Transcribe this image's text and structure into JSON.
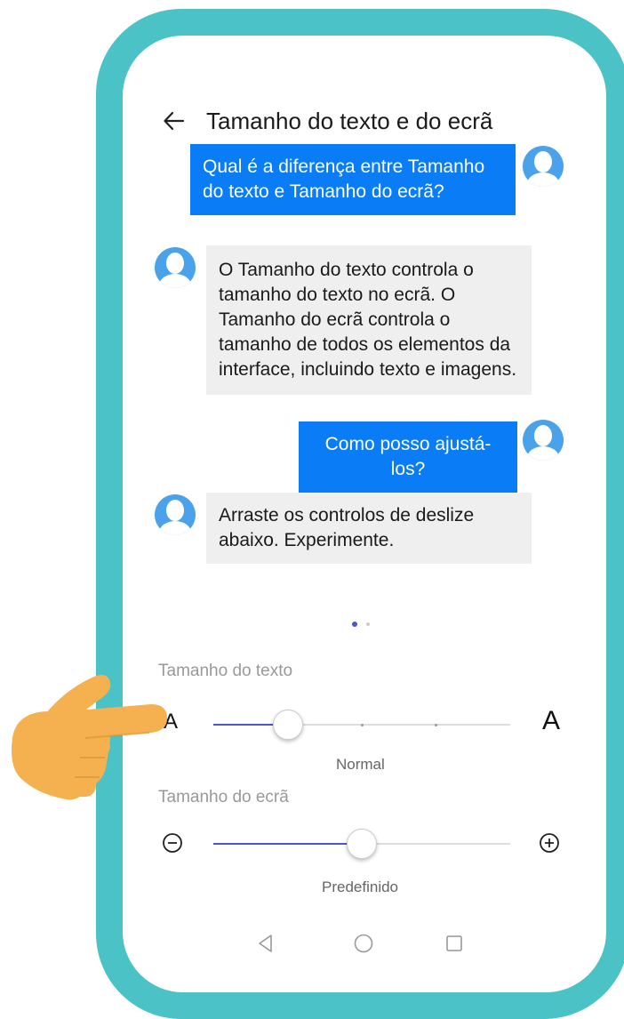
{
  "edge_text": "a",
  "header": {
    "title": "Tamanho do texto e do ecrã",
    "back_icon": "arrow-left-icon"
  },
  "chat": [
    {
      "from": "user",
      "text": "Qual é a diferença entre Tamanho do texto e Tamanho do ecrã?"
    },
    {
      "from": "assistant",
      "text": "O Tamanho do texto controla o tamanho do texto no ecrã. O Tamanho do ecrã controla o tamanho de todos os elementos da interface, incluindo texto e imagens."
    },
    {
      "from": "user",
      "text": "Como posso ajustá-los?"
    },
    {
      "from": "assistant",
      "text": "Arraste os controlos de deslize abaixo. Experimente."
    }
  ],
  "pager": {
    "count": 2,
    "active": 0
  },
  "text_size": {
    "label": "Tamanho do texto",
    "min_symbol": "A",
    "max_symbol": "A",
    "value_label": "Normal",
    "level": 0.25,
    "steps": 4
  },
  "screen_size": {
    "label": "Tamanho do ecrã",
    "min_icon": "minus-circle-icon",
    "max_icon": "plus-circle-icon",
    "value_label": "Predefinido",
    "level": 0.5
  },
  "nav": [
    "back-triangle-icon",
    "home-circle-icon",
    "recents-square-icon"
  ],
  "colors": {
    "phone_frame": "#4bc2c5",
    "user_bubble": "#0a7cf5",
    "assistant_bubble": "#efefef",
    "slider_fill": "#4f55c8",
    "hand": "#f5b04f"
  }
}
